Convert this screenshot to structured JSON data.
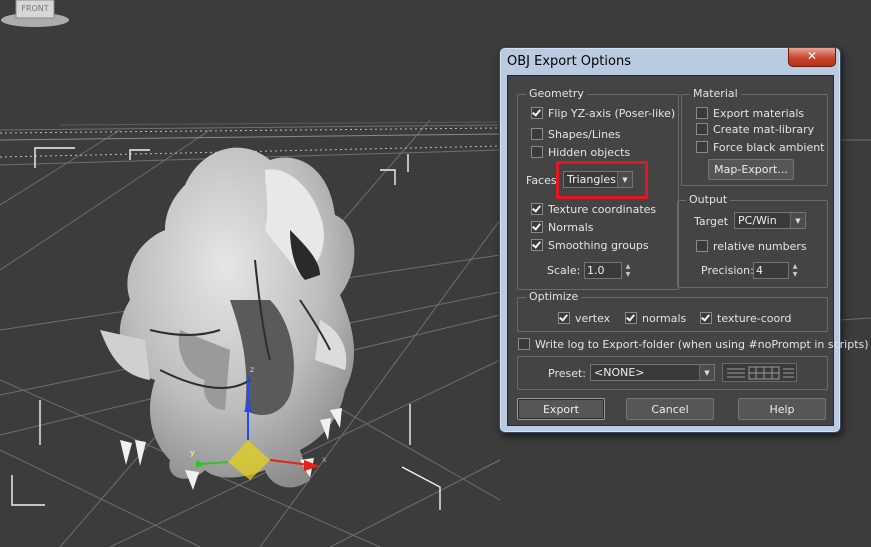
{
  "viewport": {
    "label": "3ds Max perspective viewport",
    "viewcube_label": "FRONT"
  },
  "dialog": {
    "title": "OBJ Export Options",
    "close_label": "✕",
    "geometry": {
      "legend": "Geometry",
      "flip_yz": {
        "label": "Flip YZ-axis (Poser-like)",
        "checked": true
      },
      "shapes_lines": {
        "label": "Shapes/Lines",
        "checked": false
      },
      "hidden_objects": {
        "label": "Hidden objects",
        "checked": false
      },
      "faces_label": "Faces",
      "faces_value": "Triangles",
      "texture_coords": {
        "label": "Texture coordinates",
        "checked": true
      },
      "normals": {
        "label": "Normals",
        "checked": true
      },
      "smoothing_groups": {
        "label": "Smoothing groups",
        "checked": true
      },
      "scale_label": "Scale:",
      "scale_value": "1.0"
    },
    "material": {
      "legend": "Material",
      "export_materials": {
        "label": "Export materials",
        "checked": false
      },
      "create_mat_library": {
        "label": "Create mat-library",
        "checked": false
      },
      "force_black_ambient": {
        "label": "Force black ambient",
        "checked": false
      },
      "map_export_label": "Map-Export..."
    },
    "output": {
      "legend": "Output",
      "target_label": "Target",
      "target_value": "PC/Win",
      "relative_numbers": {
        "label": "relative numbers",
        "checked": false
      },
      "precision_label": "Precision:",
      "precision_value": "4"
    },
    "optimize": {
      "legend": "Optimize",
      "vertex": {
        "label": "vertex",
        "checked": true
      },
      "normals": {
        "label": "normals",
        "checked": true
      },
      "texture_coord": {
        "label": "texture-coord",
        "checked": true
      }
    },
    "write_log": {
      "label": "Write log to Export-folder (when using #noPrompt in scripts)",
      "checked": false
    },
    "preset_label": "Preset:",
    "preset_value": "<NONE>",
    "buttons": {
      "export": "Export",
      "cancel": "Cancel",
      "help": "Help"
    }
  },
  "colors": {
    "highlight": "#e01824",
    "dialog_frame": "#b9cbe0",
    "client_bg": "#444444"
  }
}
